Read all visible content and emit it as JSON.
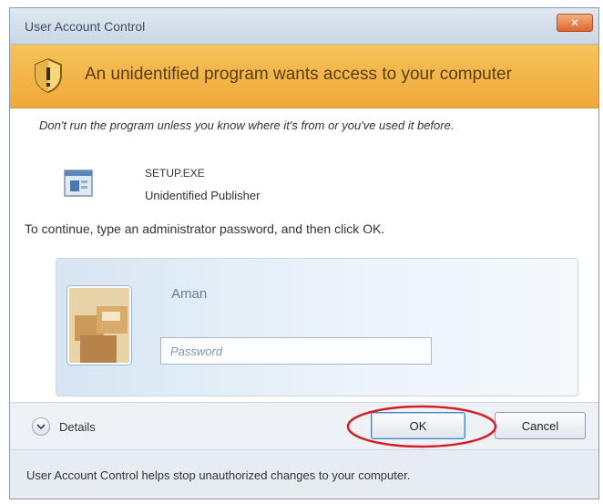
{
  "window": {
    "title": "User Account Control",
    "close_symbol": "✕"
  },
  "banner": {
    "text": "An unidentified program wants access to your computer",
    "icon": "shield-warning-icon",
    "color": "#f0a83a"
  },
  "content": {
    "warning": "Don't run the program unless you know where it's from or you've used it before.",
    "program": {
      "name": "SETUP.EXE",
      "publisher": "Unidentified Publisher",
      "icon": "program-icon"
    },
    "instruction": "To continue, type an administrator password, and then click OK."
  },
  "credentials": {
    "user_name": "Aman",
    "password_placeholder": "Password",
    "password_value": "",
    "avatar": "user-avatar-icon"
  },
  "footer": {
    "details_label": "Details",
    "ok_label": "OK",
    "cancel_label": "Cancel",
    "highlight_color": "#d0202a"
  },
  "status": {
    "text": "User Account Control helps stop unauthorized changes to your computer."
  }
}
